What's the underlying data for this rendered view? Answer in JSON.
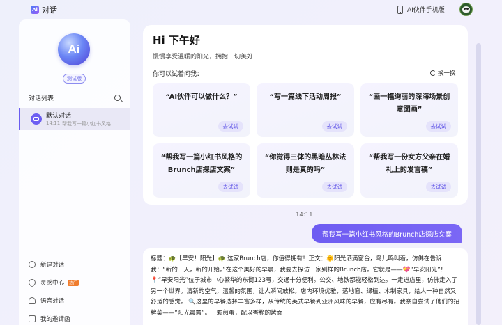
{
  "header": {
    "app_title": "对话",
    "phone_link": "AI伙伴手机版"
  },
  "sidebar": {
    "badge": "测试版",
    "list_title": "对话列表",
    "chat": {
      "title": "默认对话",
      "time": "14:11",
      "preview": "帮我写一篇小红书风格的Brunch店探店文案"
    },
    "nav": [
      {
        "label": "新建对话"
      },
      {
        "label": "灵感中心",
        "badge": "热门"
      },
      {
        "label": "语音对话"
      },
      {
        "label": "我的邀请函"
      }
    ]
  },
  "welcome": {
    "greeting": "Hi 下午好",
    "subtitle": "慢慢享受温暖的阳光，拥抱一切美好",
    "try_label": "你可以试着问我：",
    "refresh_label": "换一换",
    "cards": [
      {
        "text": "“AI伙伴可以做什么？”",
        "button": "去试试"
      },
      {
        "text": "“写一篇线下活动周报”",
        "button": "去试试"
      },
      {
        "text": "“画一幅绚丽的深海场景创意图画”",
        "button": "去试试"
      },
      {
        "text": "“帮我写一篇小红书风格的Brunch店探店文案”",
        "button": "去试试"
      },
      {
        "text": "“你觉得三体的黑暗丛林法则是真的吗”",
        "button": "去试试"
      },
      {
        "text": "“帮我写一份女方父亲在婚礼上的发言稿”",
        "button": "去试试"
      }
    ]
  },
  "conversation": {
    "timestamp": "14:11",
    "user_message": "帮我写一篇小红书风格的Brunch店探店文案",
    "answer": "标题：🐢【早安！阳光】🐢 这家Brunch店，你值得拥有！正文：🌞阳光洒满窗台，鸟儿鸣叫着，仿佛在告诉我：“新的一天，新的开始。”在这个美好的早晨，我要去探访一家别样的Brunch店。它就是——💝“早安阳光”！ 📍“早安阳光”位于城市中心繁华的东街123号，交通十分便利。公交、地铁都能轻松到达。一走进店里，仿佛走入了另一个世界。清新的空气，温馨的氛围，让人瞬间放松。店内环境优雅，落地窗、绿植、木制家具，给人一种自然又舒适的感觉。 🔍这里的早餐选择丰富多样，从传统的英式早餐到亚洲风味的早餐，应有尽有。我亲自尝试了他们的招牌菜——“阳光晨露”。一颗煎蛋，配以香脆的烤面"
  },
  "colors": {
    "accent": "#6c5ef2",
    "card_button_bg": "#e5e3fb",
    "hot_badge": "#f07d2e"
  }
}
